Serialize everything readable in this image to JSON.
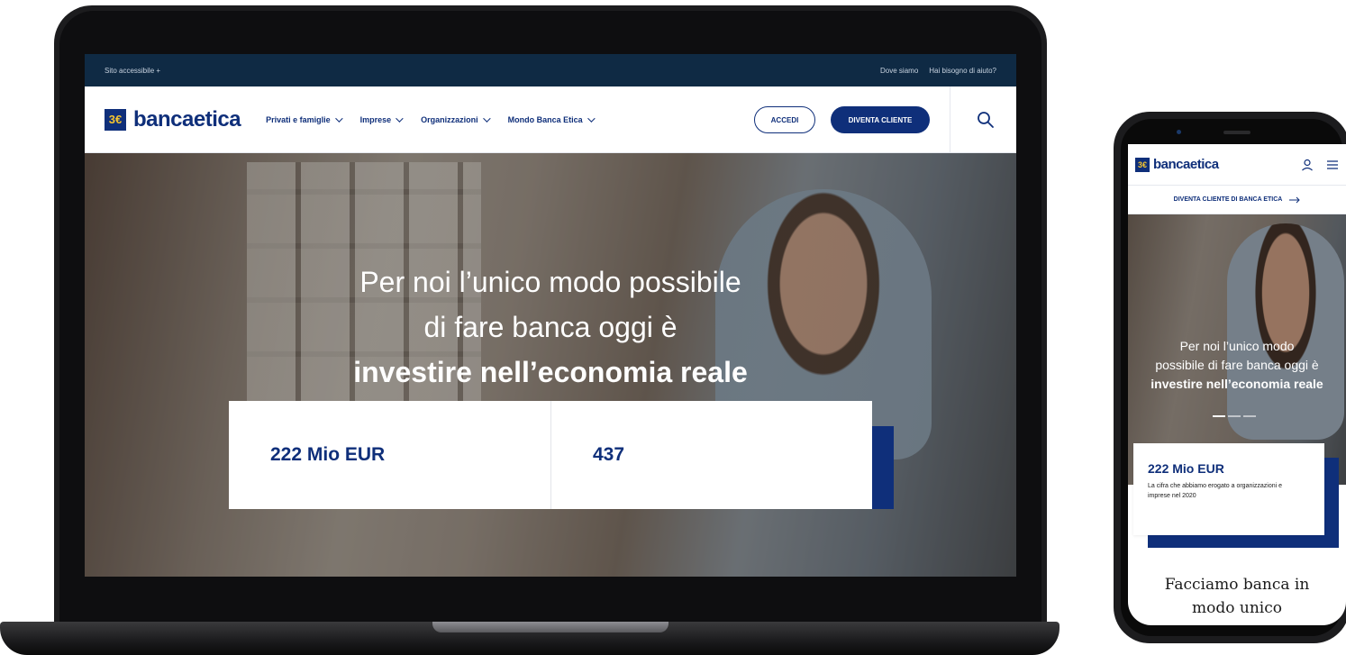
{
  "desktop": {
    "topbar": {
      "accessible_label": "Sito accessibile  +",
      "links": [
        "Dove siamo",
        "Hai bisogno di aiuto?"
      ]
    },
    "navbar": {
      "logo_mark": "3€",
      "logo_text": "bancaetica",
      "menu": [
        "Privati e famiglie",
        "Imprese",
        "Organizzazioni",
        "Mondo Banca Etica"
      ],
      "login_label": "ACCEDI",
      "signup_label": "DIVENTA CLIENTE"
    },
    "hero": {
      "line1": "Per noi l’unico modo possibile",
      "line2": "di fare banca oggi è",
      "line3": "investire nell’economia reale"
    },
    "stats": [
      "222 Mio EUR",
      "437"
    ]
  },
  "mobile": {
    "logo_text": "bancaetica",
    "cta_label": "DIVENTA CLIENTE DI BANCA ETICA",
    "hero": {
      "line1": "Per noi l’unico modo",
      "line2": "possibile di fare banca oggi è",
      "line3": "investire nell’economia reale"
    },
    "card": {
      "title": "222 Mio EUR",
      "description": "La cifra che abbiamo erogato a organizzazioni e imprese nel 2020"
    },
    "section_heading_1": "Facciamo banca in",
    "section_heading_2": "modo unico"
  },
  "colors": {
    "brand_navy": "#0f2f7a",
    "topbar": "#0f2a44",
    "logo_accent": "#f4c430"
  }
}
